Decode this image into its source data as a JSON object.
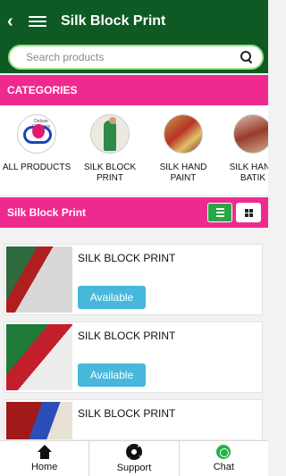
{
  "header": {
    "title": "Silk Block Print"
  },
  "search": {
    "placeholder": "Search products"
  },
  "categories": {
    "heading": "CATEGORIES",
    "items": [
      {
        "label": "ALL PRODUCTS"
      },
      {
        "label": "SILK BLOCK PRINT"
      },
      {
        "label": "SILK HAND PAINT"
      },
      {
        "label": "SILK HAND BATIK"
      }
    ]
  },
  "section": {
    "title": "Silk Block Print"
  },
  "products": [
    {
      "name": "SILK BLOCK PRINT",
      "status": "Available"
    },
    {
      "name": "SILK BLOCK PRINT",
      "status": "Available"
    },
    {
      "name": "SILK BLOCK PRINT",
      "status": ""
    }
  ],
  "nav": {
    "home": "Home",
    "support": "Support",
    "chat": "Chat"
  },
  "colors": {
    "appbar": "#0f5a24",
    "accent": "#ef2a8f",
    "available": "#47b8dc"
  }
}
